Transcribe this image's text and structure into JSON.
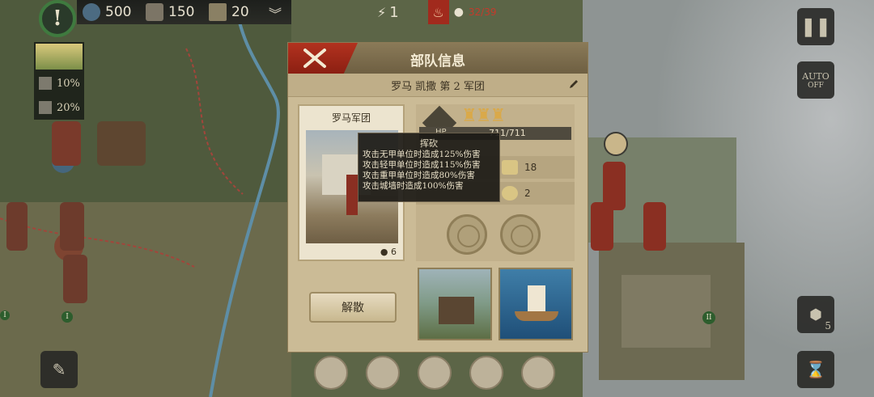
{
  "top_bar": {
    "resource_1": "500",
    "resource_2": "150",
    "resource_3": "20",
    "center_count": "1",
    "population": "32/39"
  },
  "side_panel": {
    "stat_1": "10%",
    "stat_2": "20%"
  },
  "right_buttons": {
    "auto_label": "AUTO",
    "auto_state": "OFF",
    "count": "5"
  },
  "modal": {
    "title": "部队信息",
    "subtitle": "罗马 凯撒 第  2  军团",
    "card_title": "罗马军团",
    "card_count": "6",
    "hp_label": "HP",
    "hp": "711/711",
    "stat_attack": "18",
    "stat_vision": "2",
    "disband_label": "解散",
    "tooltip": {
      "title": "挥砍",
      "lines": [
        "攻击无甲单位时造成125%伤害",
        "攻击轻甲单位时造成115%伤害",
        "攻击重甲单位时造成80%伤害",
        "攻击城墙时造成100%伤害"
      ]
    }
  },
  "map_labels": {
    "roman_1": "I",
    "roman_2": "I",
    "roman_3": "II"
  },
  "colors": {
    "accent_red": "#a12a1d",
    "panel_bg": "#cbbb96",
    "header_bg": "#7a6a4c"
  }
}
